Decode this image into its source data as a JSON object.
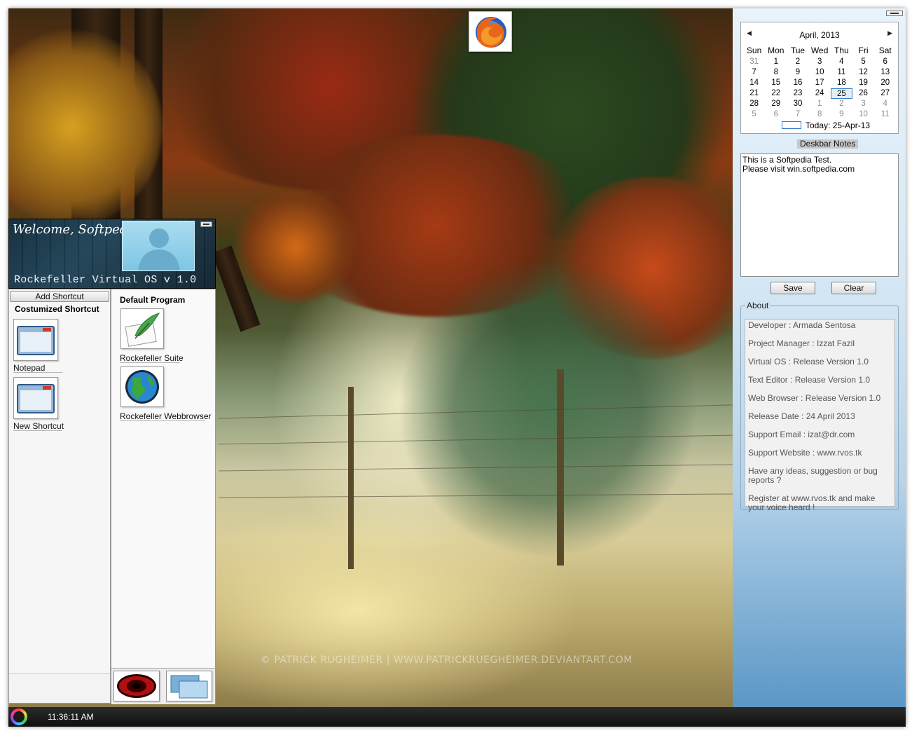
{
  "firefox": {
    "icon": "firefox-icon"
  },
  "welcome": {
    "greeting": "Welcome,  Softpedia",
    "os_title": "Rockefeller Virtual OS v 1.0"
  },
  "custom_shortcuts": {
    "add_label": "Add Shortcut",
    "header": "Costumized Shortcut",
    "items": [
      {
        "label": "Notepad",
        "icon": "window-icon"
      },
      {
        "label": "New Shortcut",
        "icon": "window-icon"
      }
    ]
  },
  "default_programs": {
    "header": "Default Program",
    "items": [
      {
        "label": "Rockefeller Suite",
        "icon": "quill-notepad-icon"
      },
      {
        "label": "Rockefeller Webbrowser",
        "icon": "globe-icon"
      }
    ],
    "dock": [
      {
        "icon": "red-eye-icon"
      },
      {
        "icon": "windows-icon"
      }
    ]
  },
  "calendar": {
    "month_label": "April, 2013",
    "weekdays": [
      "Sun",
      "Mon",
      "Tue",
      "Wed",
      "Thu",
      "Fri",
      "Sat"
    ],
    "weeks": [
      [
        "31",
        "1",
        "2",
        "3",
        "4",
        "5",
        "6"
      ],
      [
        "7",
        "8",
        "9",
        "10",
        "11",
        "12",
        "13"
      ],
      [
        "14",
        "15",
        "16",
        "17",
        "18",
        "19",
        "20"
      ],
      [
        "21",
        "22",
        "23",
        "24",
        "25",
        "26",
        "27"
      ],
      [
        "28",
        "29",
        "30",
        "1",
        "2",
        "3",
        "4"
      ],
      [
        "5",
        "6",
        "7",
        "8",
        "9",
        "10",
        "11"
      ]
    ],
    "selected": "25",
    "today_label": "Today: 25-Apr-13"
  },
  "notes": {
    "label": "Deskbar Notes",
    "text": "This is a Softpedia Test.\nPlease visit win.softpedia.com",
    "save_label": "Save",
    "clear_label": "Clear"
  },
  "about": {
    "legend": "About",
    "items": [
      "Developer : Armada Sentosa",
      "Project Manager : Izzat Fazil",
      "Virtual OS : Release Version 1.0",
      "Text Editor : Release Version 1.0",
      "Web Browser : Release Version 1.0",
      "Release Date : 24 April 2013",
      "Support Email : izat@dr.com",
      "Support Website : www.rvos.tk",
      "Have any ideas, suggestion or bug reports ?",
      "Register at www.rvos.tk and make your voice heard !"
    ]
  },
  "wallpaper": {
    "watermark": "© PATRICK RUGHEIMER | WWW.PATRICKRUEGHEIMER.DEVIANTART.COM"
  },
  "taskbar": {
    "clock": "11:36:11 AM"
  }
}
